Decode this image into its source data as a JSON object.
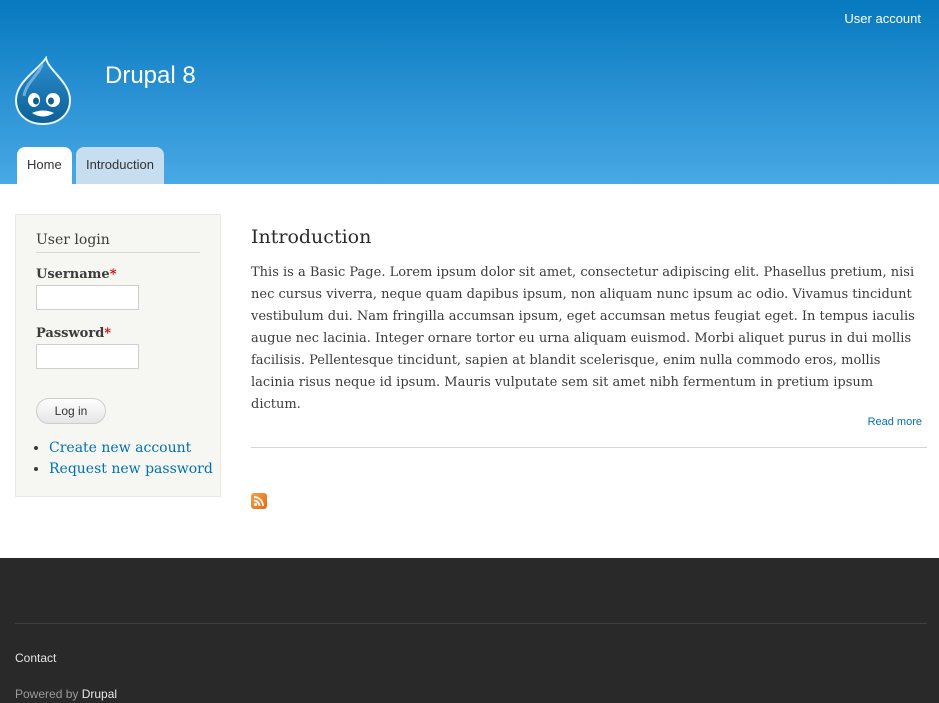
{
  "header": {
    "secondary_menu": "User account",
    "site_name": "Drupal 8",
    "tabs": [
      {
        "label": "Home",
        "active": true
      },
      {
        "label": "Introduction",
        "active": false
      }
    ],
    "logo_icon": "drupal-drop-logo",
    "gradient_top": "#0779bf",
    "gradient_bottom": "#48a9e4"
  },
  "sidebar": {
    "block_title": "User login",
    "username_label": "Username",
    "password_label": "Password",
    "required_marker": "*",
    "username_value": "",
    "password_value": "",
    "login_button": "Log in",
    "links": [
      "Create new account",
      "Request new password"
    ]
  },
  "main": {
    "title": "Introduction",
    "body": "This is a Basic Page. Lorem ipsum dolor sit amet, consectetur adipiscing elit. Phasellus pretium, nisi nec cursus viverra, neque quam dapibus ipsum, non aliquam nunc ipsum ac odio. Vivamus tincidunt vestibulum dui. Nam fringilla accumsan ipsum, eget accumsan metus feugiat eget. In tempus iaculis augue nec lacinia. Integer ornare tortor eu urna aliquam euismod. Morbi aliquet purus in dui mollis facilisis. Pellentesque tincidunt, sapien at blandit scelerisque, enim nulla commodo eros, mollis lacinia risus neque id ipsum. Mauris vulputate sem sit amet nibh fermentum in pretium ipsum dictum.",
    "read_more": "Read more",
    "feed_icon": "rss-feed-icon",
    "link_color": "#0071b3"
  },
  "footer": {
    "contact": "Contact",
    "powered_prefix": "Powered by ",
    "powered_link": "Drupal",
    "background": "#292929"
  }
}
